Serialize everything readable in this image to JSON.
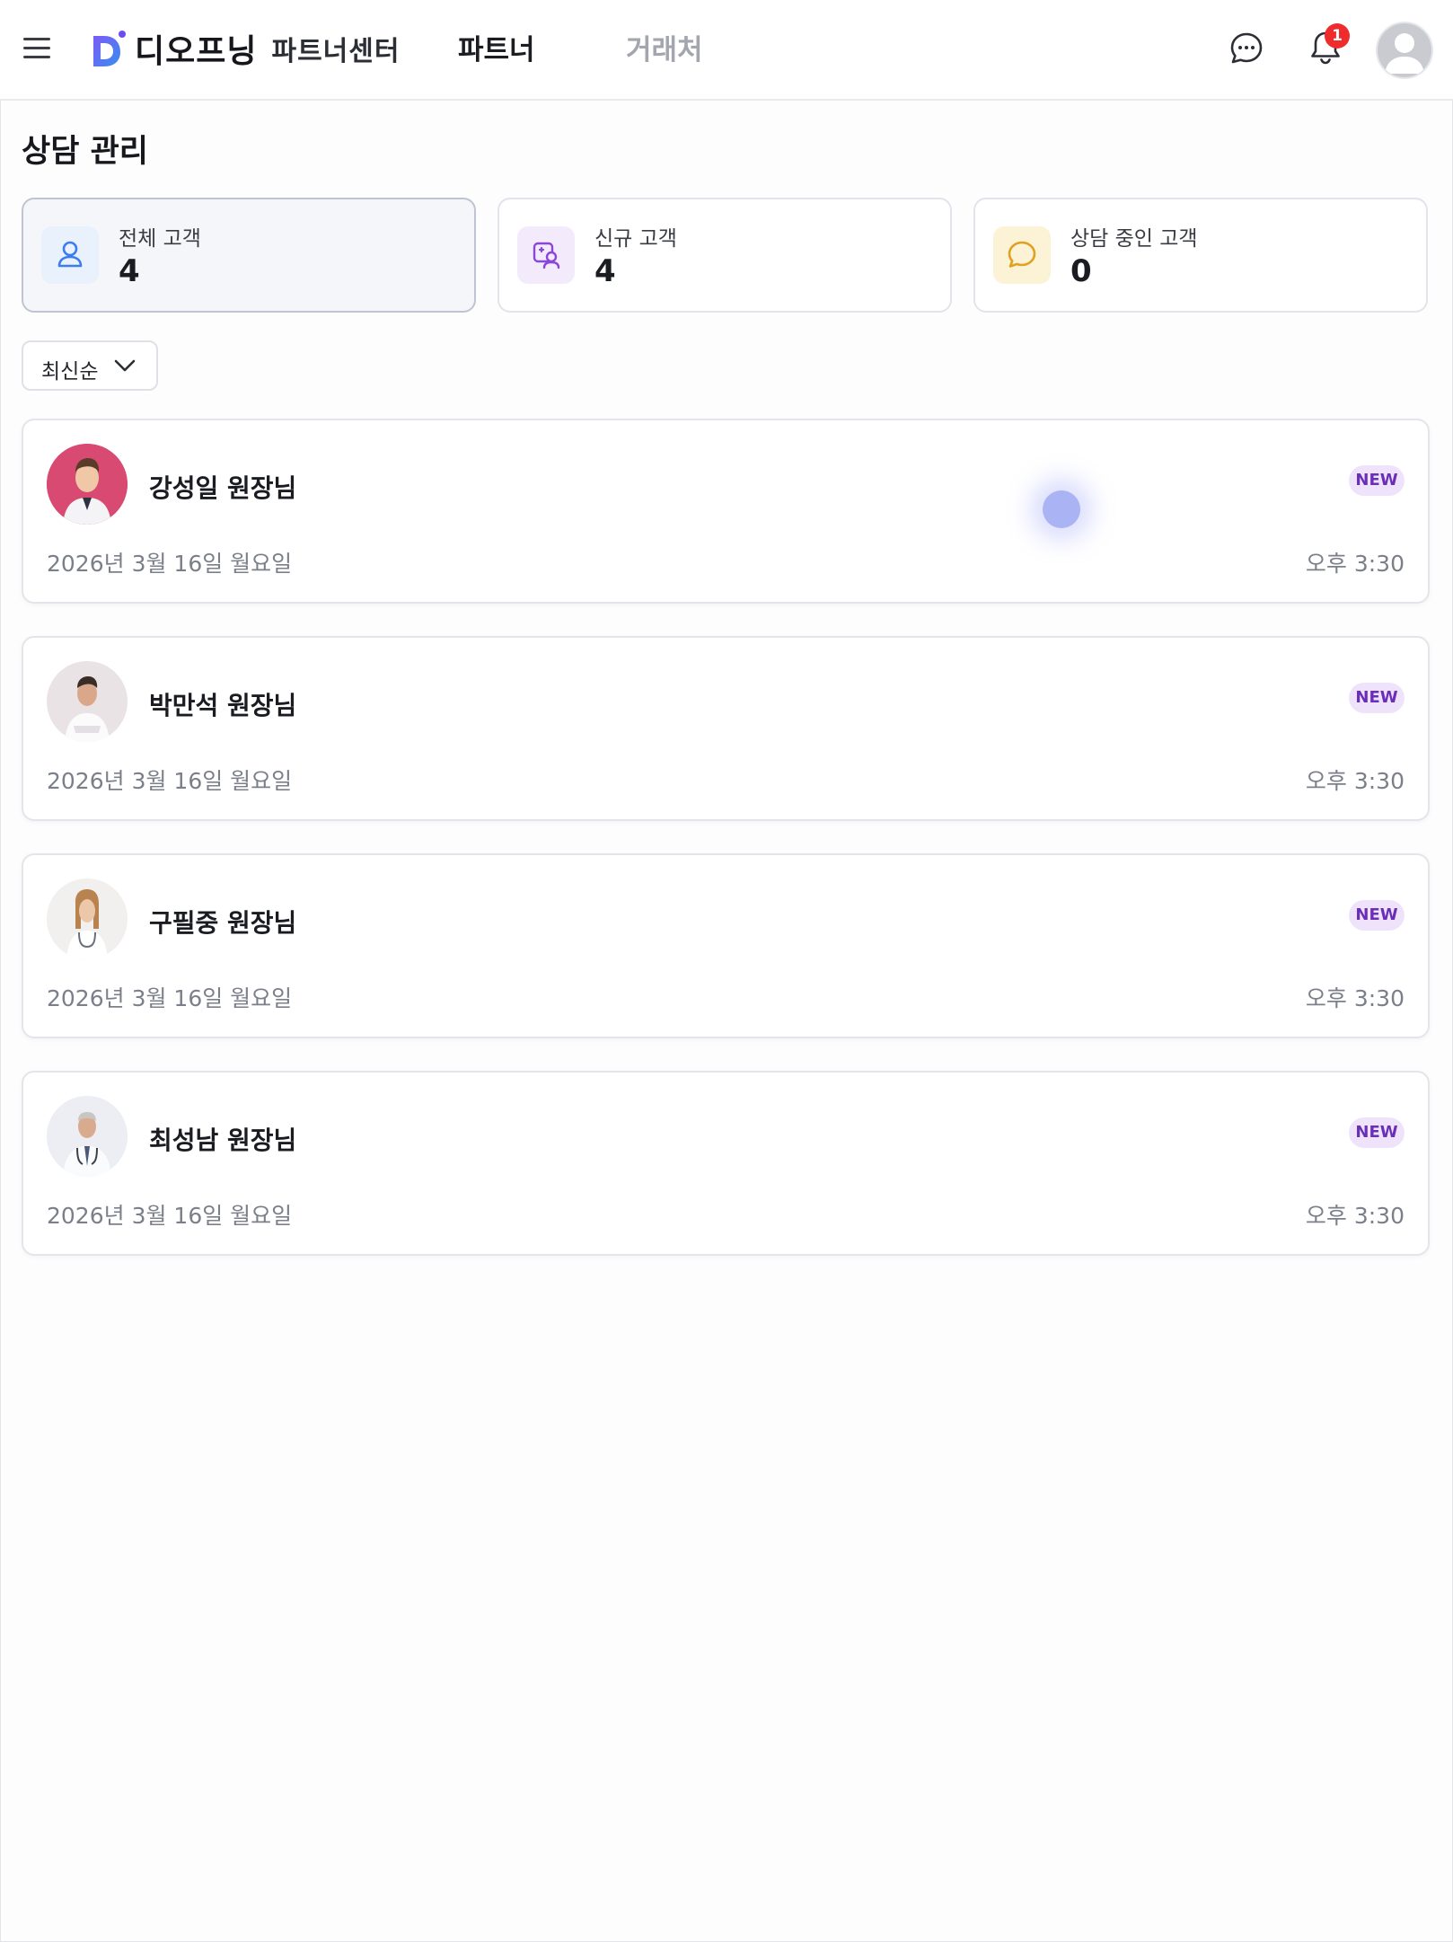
{
  "header": {
    "logo_text": "디오프닝",
    "logo_sub": "파트너센터",
    "tabs": [
      {
        "label": "파트너",
        "active": true
      },
      {
        "label": "거래처",
        "active": false
      }
    ],
    "notification_count": "1",
    "icons": [
      "menu-icon",
      "chat-icon",
      "bell-icon",
      "profile-avatar"
    ]
  },
  "page": {
    "title": "상담 관리"
  },
  "stats": [
    {
      "label": "전체 고객",
      "value": "4",
      "icon": "user-icon",
      "color": "#3b7cf0",
      "selected": true
    },
    {
      "label": "신규 고객",
      "value": "4",
      "icon": "new-user-icon",
      "color": "#8b46d8",
      "selected": false
    },
    {
      "label": "상담 중인 고객",
      "value": "0",
      "icon": "chat-bubble-icon",
      "color": "#e0a020",
      "selected": false
    }
  ],
  "sort": {
    "label": "최신순"
  },
  "customers": [
    {
      "name": "강성일 원장님",
      "badge": "NEW",
      "date": "2026년 3월 16일 월요일",
      "time": "오후 3:30"
    },
    {
      "name": "박만석 원장님",
      "badge": "NEW",
      "date": "2026년 3월 16일 월요일",
      "time": "오후 3:30"
    },
    {
      "name": "구필중 원장님",
      "badge": "NEW",
      "date": "2026년 3월 16일 월요일",
      "time": "오후 3:30"
    },
    {
      "name": "최성남 원장님",
      "badge": "NEW",
      "date": "2026년 3월 16일 월요일",
      "time": "오후 3:30"
    }
  ],
  "colors": {
    "accent": "#6a4cf0",
    "badge_bg": "#efe3fb",
    "badge_text": "#6a2fb6",
    "notification": "#ef2b2b"
  }
}
